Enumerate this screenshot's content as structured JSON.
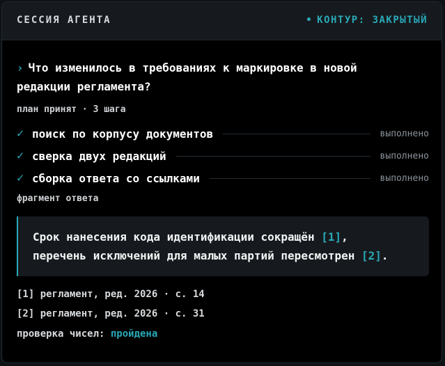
{
  "colors": {
    "accent": "#29a9b8",
    "background": "#000000",
    "header_bg": "#161a1e"
  },
  "header": {
    "title": "СЕССИЯ АГЕНТА",
    "status_dot": "•",
    "status": "КОНТУР: ЗАКРЫТЫЙ"
  },
  "query": {
    "prompt_icon": "chevron-right-icon",
    "prompt_glyph": "›",
    "text": "Что изменилось в требованиях к маркировке в новой редакции регламента?"
  },
  "plan": {
    "text": "план принят · 3 шага",
    "check_glyph": "✓",
    "steps": [
      {
        "label": "поиск по корпусу документов",
        "state": "выполнено"
      },
      {
        "label": "сверка двух редакций",
        "state": "выполнено"
      },
      {
        "label": "сборка ответа со ссылками",
        "state": "выполнено"
      }
    ]
  },
  "fragment": {
    "label": "фрагмент ответа",
    "line1_text": "Срок нанесения кода идентификации сокращён ",
    "line1_cite": "[1]",
    "line1_tail": ",",
    "line2_text": "перечень исключений для малых партий пересмотрен ",
    "line2_cite": "[2]",
    "line2_tail": "."
  },
  "references": [
    "[1] регламент, ред. 2026 · с. 14",
    "[2] регламент, ред. 2026 · с. 31"
  ],
  "verification": {
    "label": "проверка чисел: ",
    "status": "пройдена"
  }
}
